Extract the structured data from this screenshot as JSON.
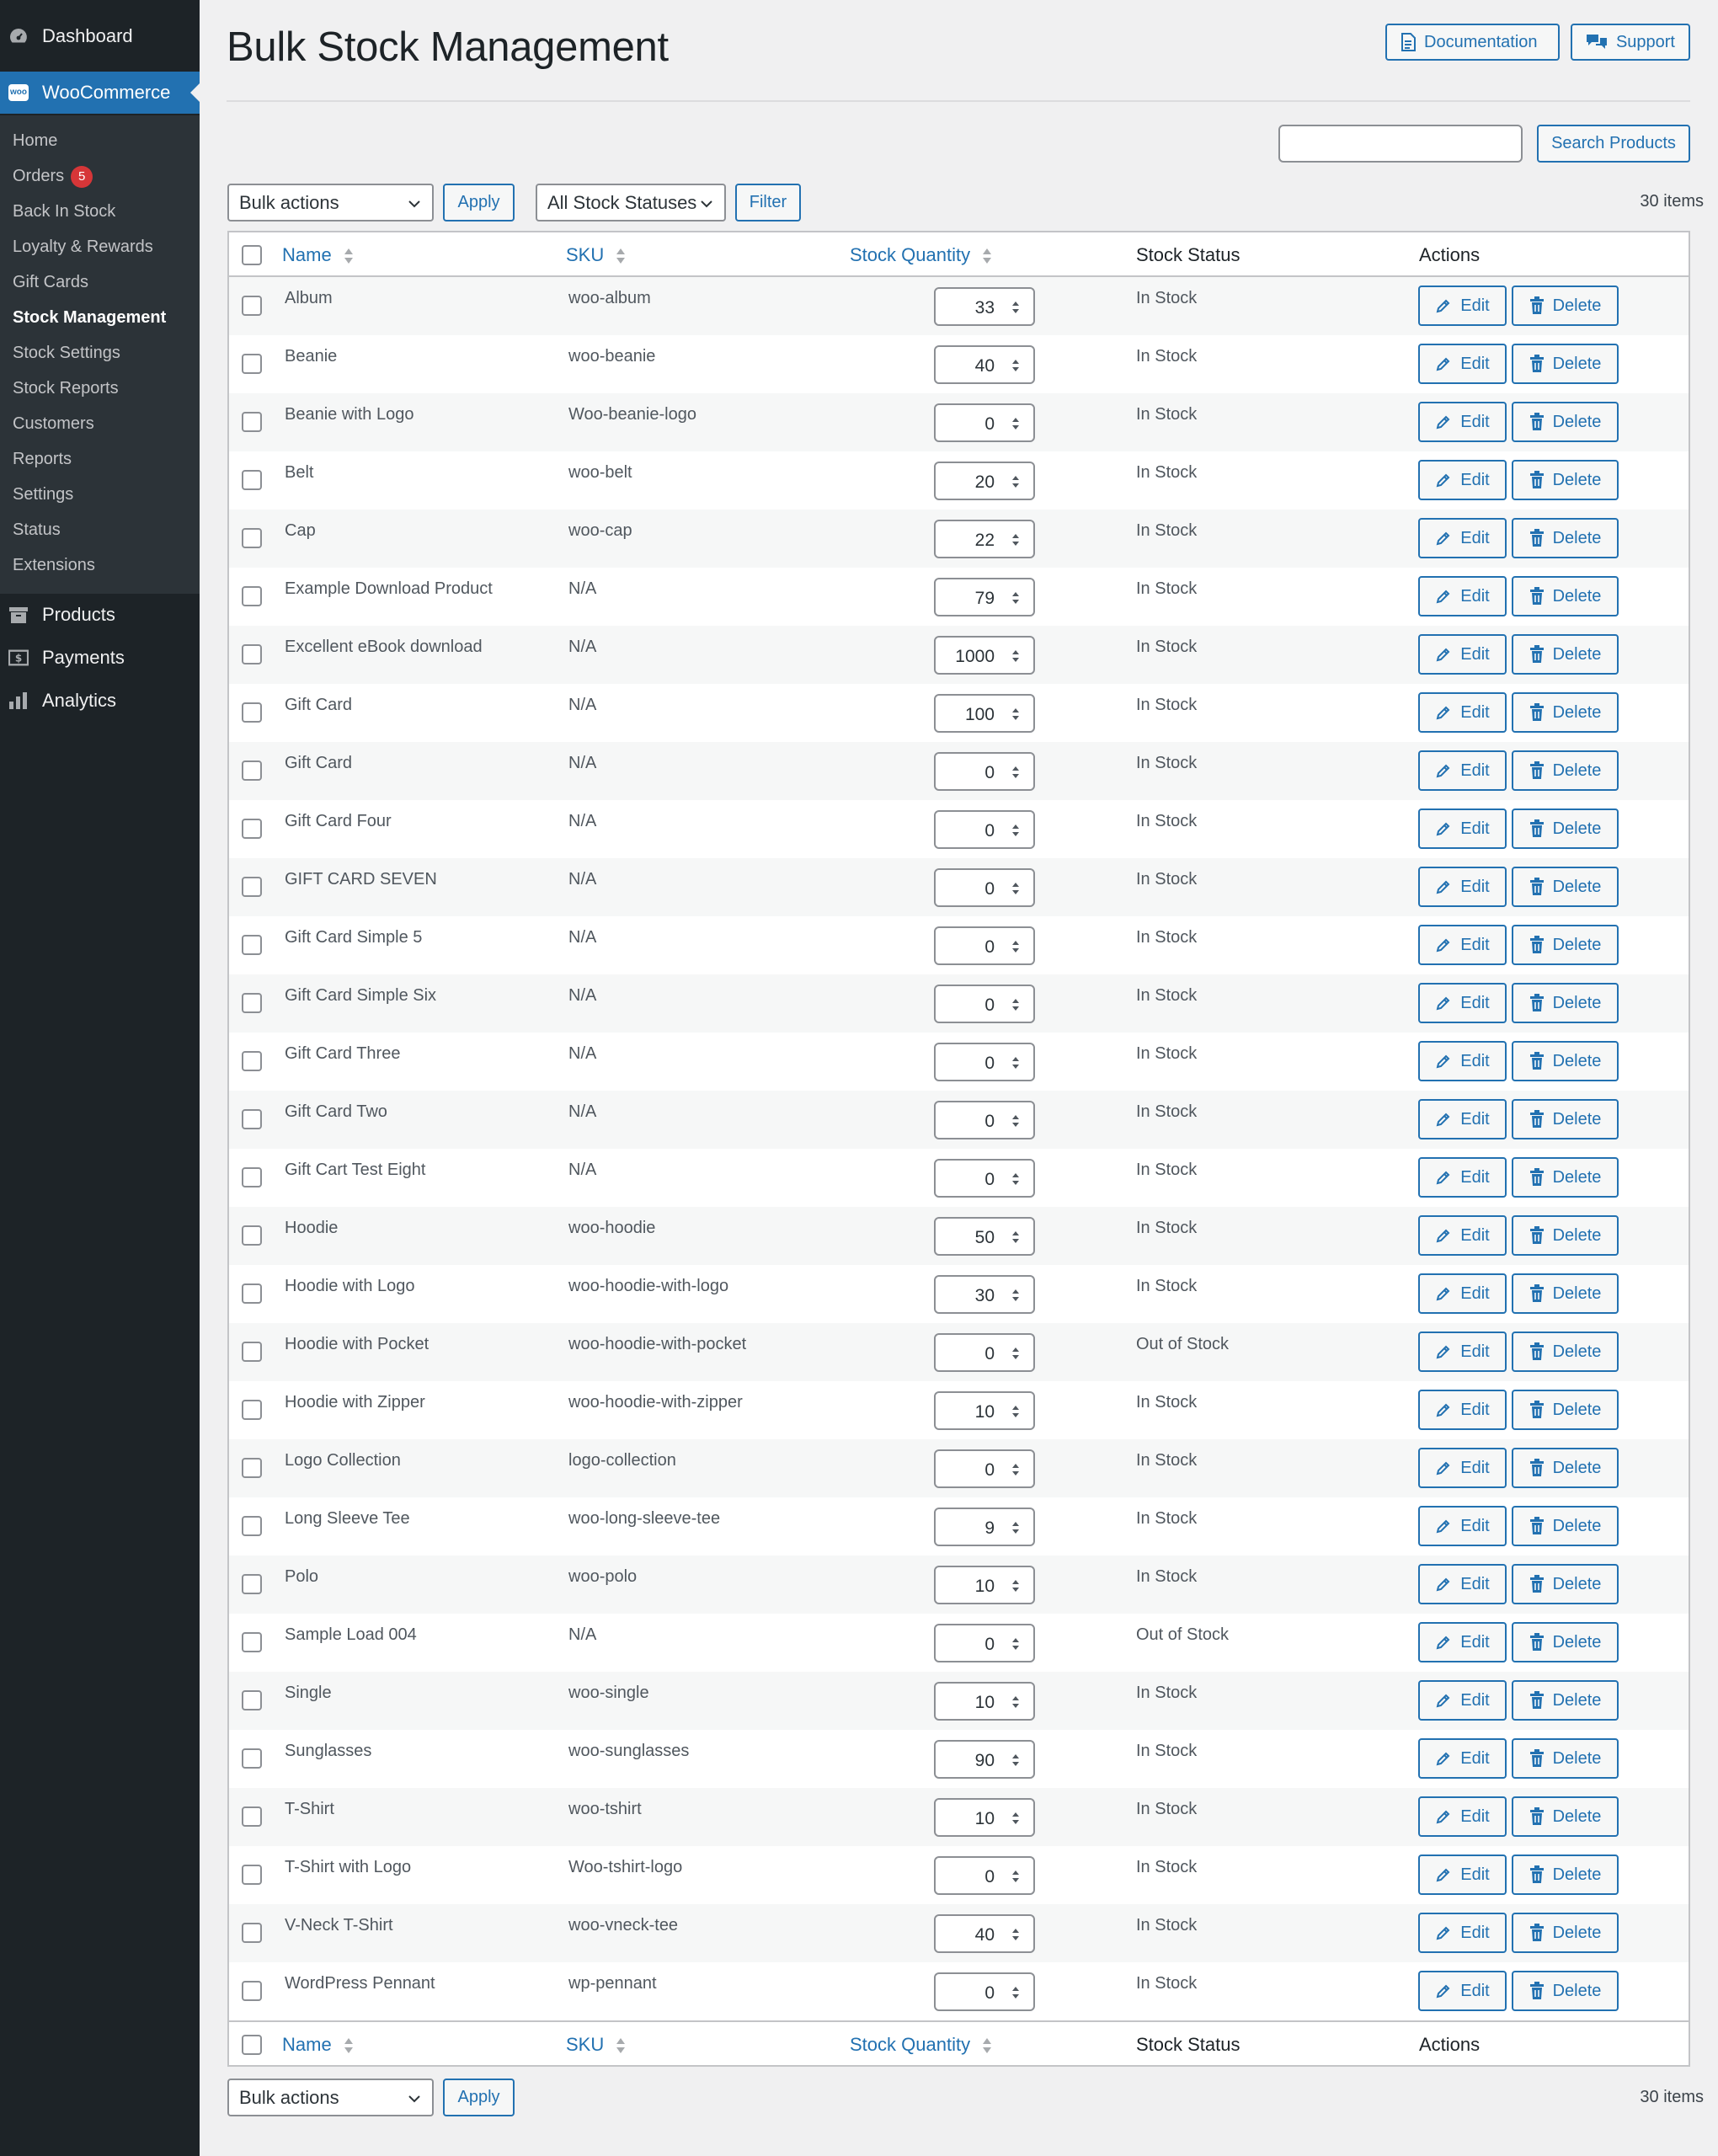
{
  "sidebar": {
    "dashboard": "Dashboard",
    "woocommerce": "WooCommerce",
    "woo_logo_text": "woo",
    "submenu": [
      {
        "label": "Home"
      },
      {
        "label": "Orders",
        "badge": "5"
      },
      {
        "label": "Back In Stock"
      },
      {
        "label": "Loyalty & Rewards"
      },
      {
        "label": "Gift Cards"
      },
      {
        "label": "Stock Management",
        "current": true
      },
      {
        "label": "Stock Settings"
      },
      {
        "label": "Stock Reports"
      },
      {
        "label": "Customers"
      },
      {
        "label": "Reports"
      },
      {
        "label": "Settings"
      },
      {
        "label": "Status"
      },
      {
        "label": "Extensions"
      }
    ],
    "products": "Products",
    "payments": "Payments",
    "analytics": "Analytics"
  },
  "header": {
    "title": "Bulk Stock Management",
    "documentation": "Documentation",
    "support": "Support"
  },
  "search": {
    "value": "",
    "button": "Search Products"
  },
  "filters": {
    "bulk_actions": "Bulk actions",
    "apply": "Apply",
    "stock_status": "All Stock Statuses",
    "filter": "Filter",
    "items_count": "30 items"
  },
  "table": {
    "columns": {
      "name": "Name",
      "sku": "SKU",
      "stock_quantity": "Stock Quantity",
      "stock_status": "Stock Status",
      "actions": "Actions"
    },
    "edit_label": "Edit",
    "delete_label": "Delete",
    "rows": [
      {
        "name": "Album",
        "sku": "woo-album",
        "qty": "33",
        "status": "In Stock"
      },
      {
        "name": "Beanie",
        "sku": "woo-beanie",
        "qty": "40",
        "status": "In Stock"
      },
      {
        "name": "Beanie with Logo",
        "sku": "Woo-beanie-logo",
        "qty": "0",
        "status": "In Stock"
      },
      {
        "name": "Belt",
        "sku": "woo-belt",
        "qty": "20",
        "status": "In Stock"
      },
      {
        "name": "Cap",
        "sku": "woo-cap",
        "qty": "22",
        "status": "In Stock"
      },
      {
        "name": "Example Download Product",
        "sku": "N/A",
        "qty": "79",
        "status": "In Stock"
      },
      {
        "name": "Excellent eBook download",
        "sku": "N/A",
        "qty": "1000",
        "status": "In Stock"
      },
      {
        "name": "Gift Card",
        "sku": "N/A",
        "qty": "100",
        "status": "In Stock"
      },
      {
        "name": "Gift Card",
        "sku": "N/A",
        "qty": "0",
        "status": "In Stock"
      },
      {
        "name": "Gift Card Four",
        "sku": "N/A",
        "qty": "0",
        "status": "In Stock"
      },
      {
        "name": "GIFT CARD SEVEN",
        "sku": "N/A",
        "qty": "0",
        "status": "In Stock"
      },
      {
        "name": "Gift Card Simple 5",
        "sku": "N/A",
        "qty": "0",
        "status": "In Stock"
      },
      {
        "name": "Gift Card Simple Six",
        "sku": "N/A",
        "qty": "0",
        "status": "In Stock"
      },
      {
        "name": "Gift Card Three",
        "sku": "N/A",
        "qty": "0",
        "status": "In Stock"
      },
      {
        "name": "Gift Card Two",
        "sku": "N/A",
        "qty": "0",
        "status": "In Stock"
      },
      {
        "name": "Gift Cart Test Eight",
        "sku": "N/A",
        "qty": "0",
        "status": "In Stock"
      },
      {
        "name": "Hoodie",
        "sku": "woo-hoodie",
        "qty": "50",
        "status": "In Stock"
      },
      {
        "name": "Hoodie with Logo",
        "sku": "woo-hoodie-with-logo",
        "qty": "30",
        "status": "In Stock"
      },
      {
        "name": "Hoodie with Pocket",
        "sku": "woo-hoodie-with-pocket",
        "qty": "0",
        "status": "Out of Stock"
      },
      {
        "name": "Hoodie with Zipper",
        "sku": "woo-hoodie-with-zipper",
        "qty": "10",
        "status": "In Stock"
      },
      {
        "name": "Logo Collection",
        "sku": "logo-collection",
        "qty": "0",
        "status": "In Stock"
      },
      {
        "name": "Long Sleeve Tee",
        "sku": "woo-long-sleeve-tee",
        "qty": "9",
        "status": "In Stock"
      },
      {
        "name": "Polo",
        "sku": "woo-polo",
        "qty": "10",
        "status": "In Stock"
      },
      {
        "name": "Sample Load 004",
        "sku": "N/A",
        "qty": "0",
        "status": "Out of Stock"
      },
      {
        "name": "Single",
        "sku": "woo-single",
        "qty": "10",
        "status": "In Stock"
      },
      {
        "name": "Sunglasses",
        "sku": "woo-sunglasses",
        "qty": "90",
        "status": "In Stock"
      },
      {
        "name": "T-Shirt",
        "sku": "woo-tshirt",
        "qty": "10",
        "status": "In Stock"
      },
      {
        "name": "T-Shirt with Logo",
        "sku": "Woo-tshirt-logo",
        "qty": "0",
        "status": "In Stock"
      },
      {
        "name": "V-Neck T-Shirt",
        "sku": "woo-vneck-tee",
        "qty": "40",
        "status": "In Stock"
      },
      {
        "name": "WordPress Pennant",
        "sku": "wp-pennant",
        "qty": "0",
        "status": "In Stock"
      }
    ]
  },
  "colors": {
    "sidebar_bg": "#1d2327",
    "submenu_bg": "#2c3338",
    "accent": "#2271b1",
    "badge": "#d63638"
  }
}
